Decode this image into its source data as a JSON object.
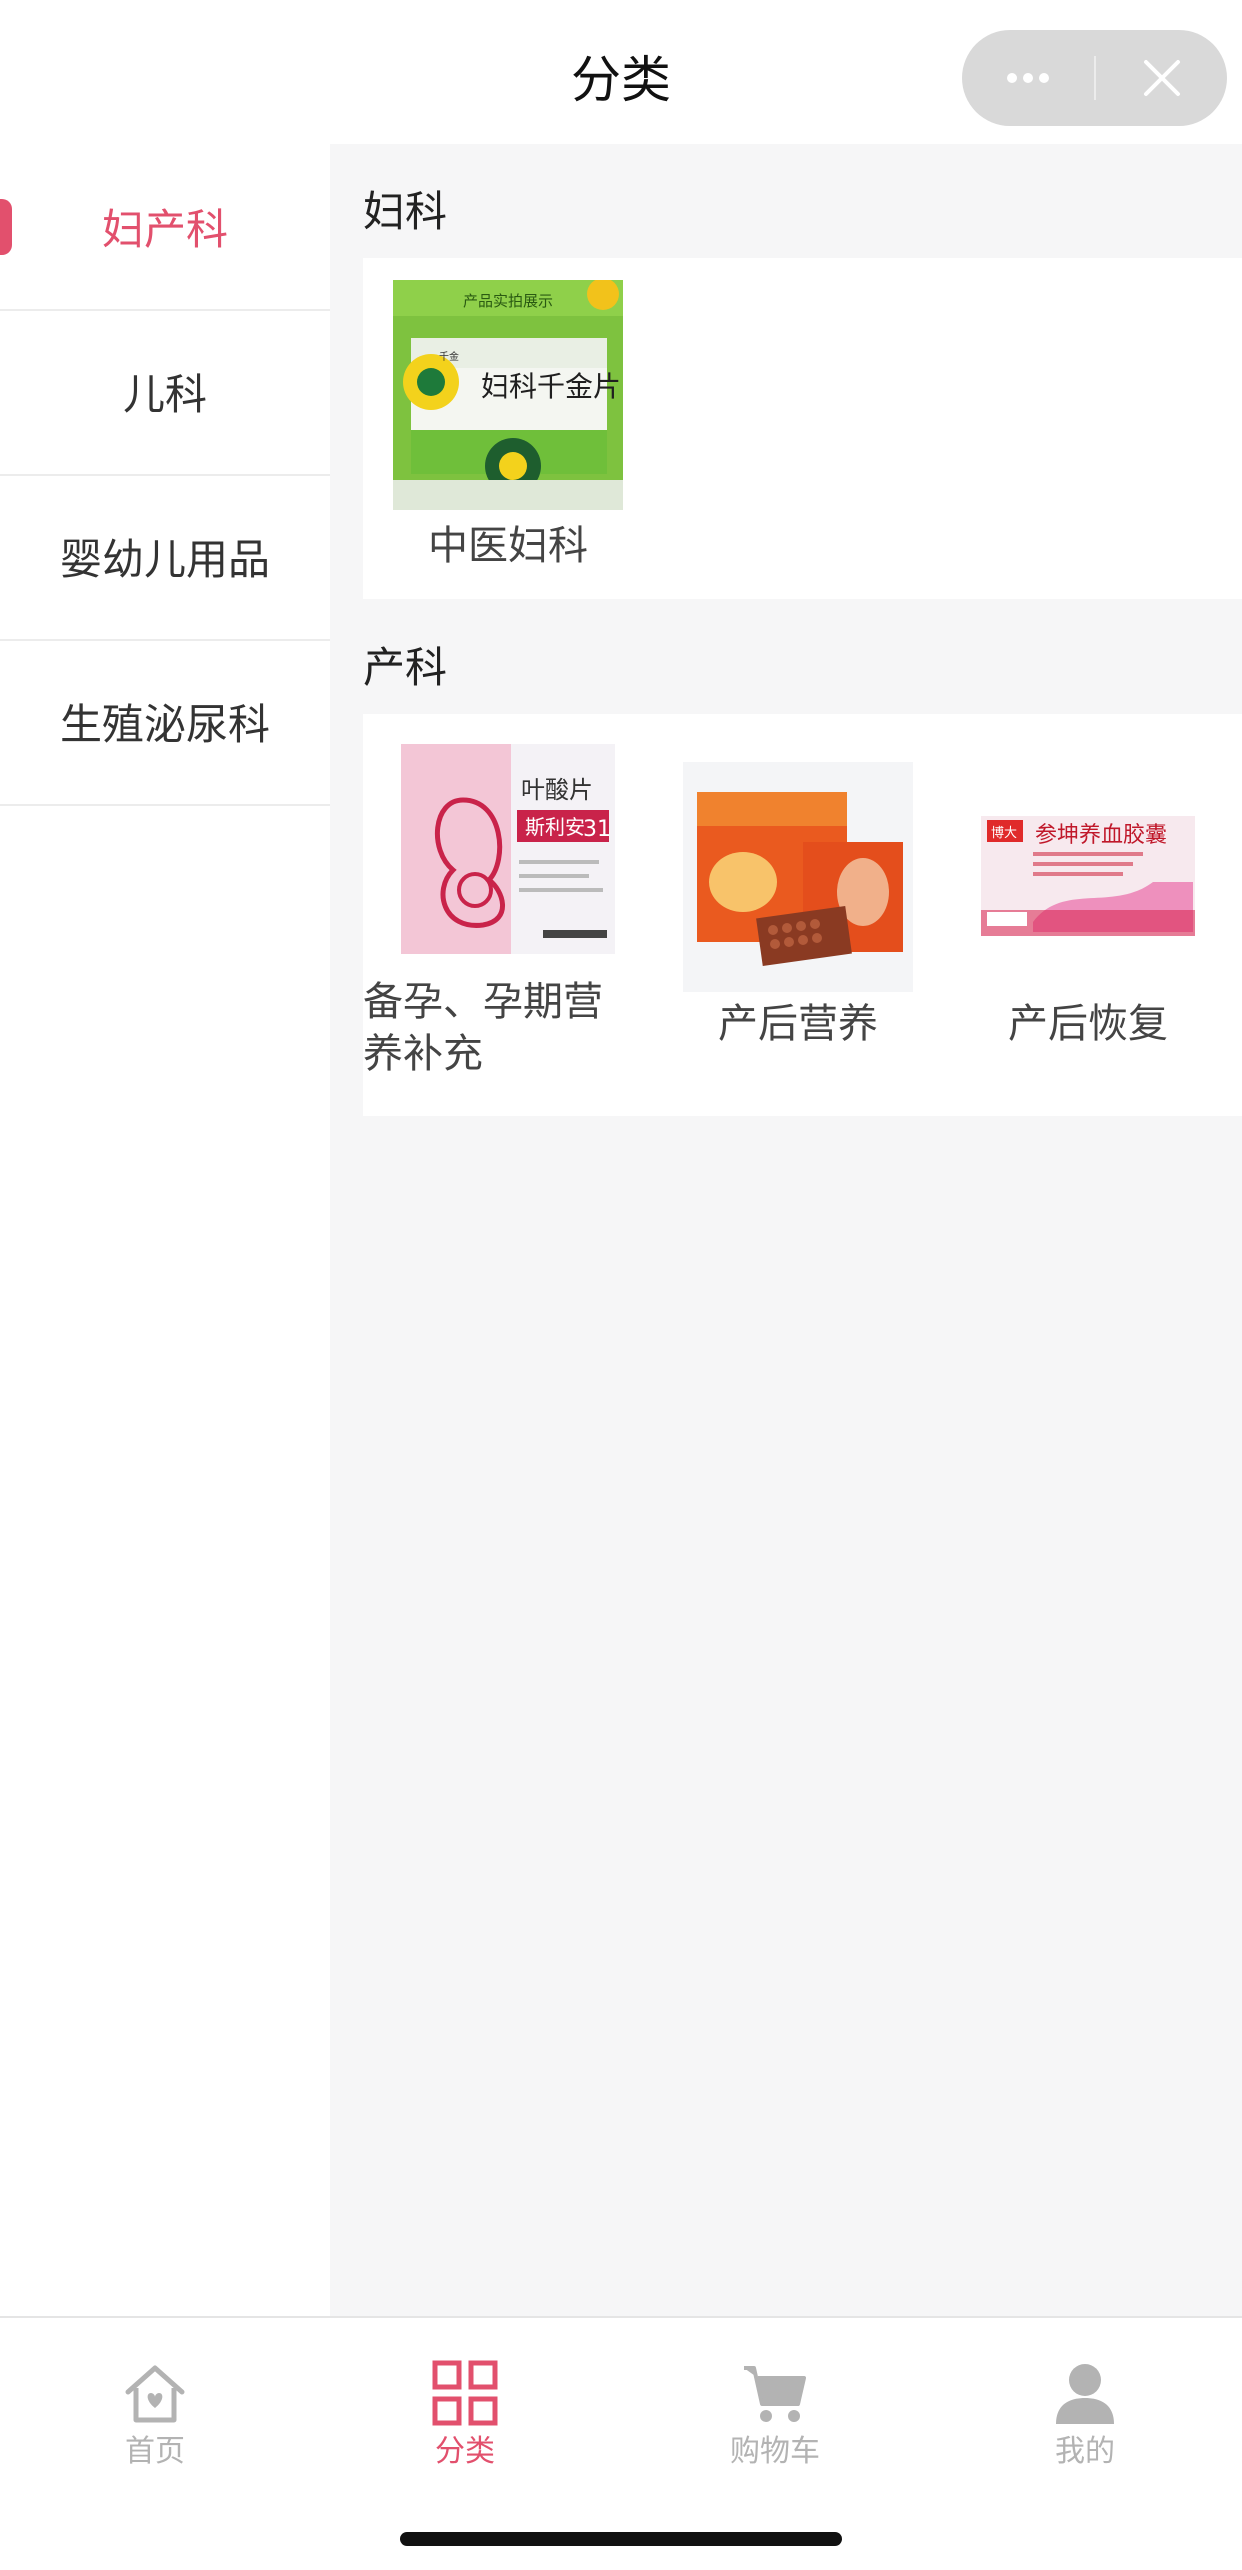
{
  "nav": {
    "title": "分类"
  },
  "sidebar": {
    "items": [
      {
        "label": "妇产科"
      },
      {
        "label": "儿科"
      },
      {
        "label": "婴幼儿用品"
      },
      {
        "label": "生殖泌尿科"
      }
    ]
  },
  "sections": [
    {
      "title": "妇科",
      "products": [
        {
          "label": "中医妇科",
          "image_caption": "产品实拍展示",
          "box_brand": "千金",
          "box_name": "妇科千金片"
        }
      ]
    },
    {
      "title": "产科",
      "products": [
        {
          "label_line1": "备孕、孕期营",
          "label_line2": "养补充",
          "box_name": "叶酸片",
          "box_brand": "斯利安",
          "box_badge": "31"
        },
        {
          "label": "产后营养"
        },
        {
          "label": "产后恢复",
          "box_brand": "博大",
          "box_name": "参坤养血胶囊"
        }
      ]
    }
  ],
  "tabbar": {
    "items": [
      {
        "label": "首页",
        "icon": "home-heart-icon"
      },
      {
        "label": "分类",
        "icon": "grid-icon"
      },
      {
        "label": "购物车",
        "icon": "cart-icon"
      },
      {
        "label": "我的",
        "icon": "user-icon"
      }
    ]
  },
  "colors": {
    "accent": "#e2506d",
    "inactive": "#b3b3b3",
    "content_bg": "#f6f6f7"
  }
}
